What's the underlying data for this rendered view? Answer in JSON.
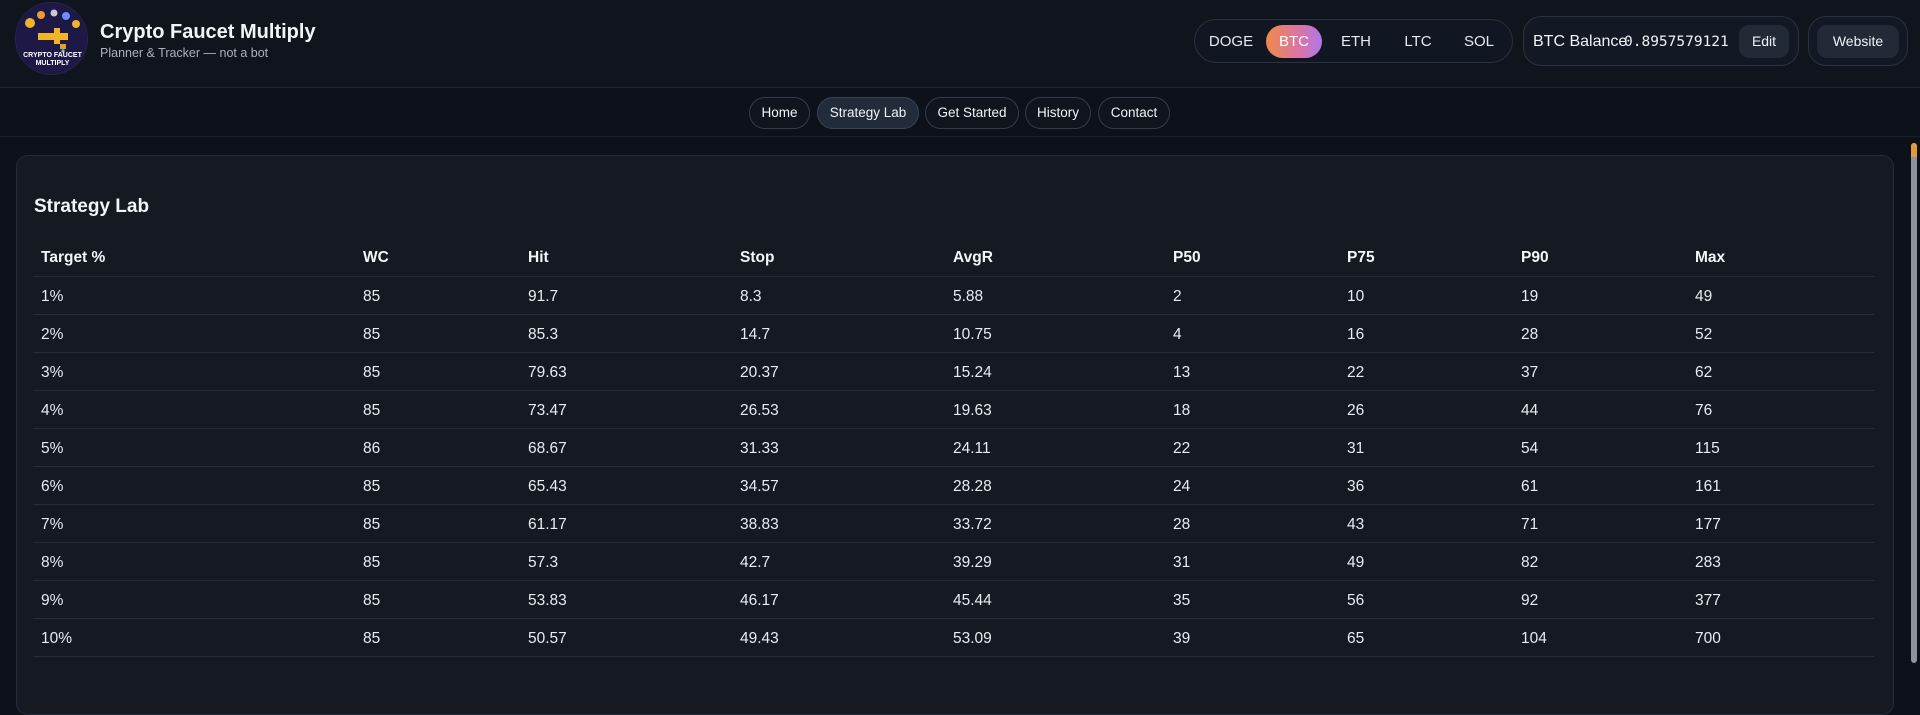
{
  "header": {
    "logo_text": "CRYPTO FAUCET MULTIPLY",
    "title": "Crypto Faucet Multiply",
    "subtitle": "Planner & Tracker — not a bot"
  },
  "coins": [
    {
      "label": "DOGE",
      "active": false
    },
    {
      "label": "BTC",
      "active": true
    },
    {
      "label": "ETH",
      "active": false
    },
    {
      "label": "LTC",
      "active": false
    },
    {
      "label": "SOL",
      "active": false
    }
  ],
  "balance": {
    "label": "BTC Balance",
    "value": "0.8957579121",
    "edit_label": "Edit"
  },
  "website_label": "Website",
  "nav": [
    {
      "label": "Home",
      "active": false
    },
    {
      "label": "Strategy Lab",
      "active": true
    },
    {
      "label": "Get Started",
      "active": false
    },
    {
      "label": "History",
      "active": false
    },
    {
      "label": "Contact",
      "active": false
    }
  ],
  "strategy": {
    "title": "Strategy Lab",
    "columns": [
      "Target %",
      "WC",
      "Hit",
      "Stop",
      "AvgR",
      "P50",
      "P75",
      "P90",
      "Max"
    ],
    "rows": [
      [
        "1%",
        "85",
        "91.7",
        "8.3",
        "5.88",
        "2",
        "10",
        "19",
        "49"
      ],
      [
        "2%",
        "85",
        "85.3",
        "14.7",
        "10.75",
        "4",
        "16",
        "28",
        "52"
      ],
      [
        "3%",
        "85",
        "79.63",
        "20.37",
        "15.24",
        "13",
        "22",
        "37",
        "62"
      ],
      [
        "4%",
        "85",
        "73.47",
        "26.53",
        "19.63",
        "18",
        "26",
        "44",
        "76"
      ],
      [
        "5%",
        "86",
        "68.67",
        "31.33",
        "24.11",
        "22",
        "31",
        "54",
        "115"
      ],
      [
        "6%",
        "85",
        "65.43",
        "34.57",
        "28.28",
        "24",
        "36",
        "61",
        "161"
      ],
      [
        "7%",
        "85",
        "61.17",
        "38.83",
        "33.72",
        "28",
        "43",
        "71",
        "177"
      ],
      [
        "8%",
        "85",
        "57.3",
        "42.7",
        "39.29",
        "31",
        "49",
        "82",
        "283"
      ],
      [
        "9%",
        "85",
        "53.83",
        "46.17",
        "45.44",
        "35",
        "56",
        "92",
        "377"
      ],
      [
        "10%",
        "85",
        "50.57",
        "49.43",
        "53.09",
        "39",
        "65",
        "104",
        "700"
      ]
    ]
  }
}
